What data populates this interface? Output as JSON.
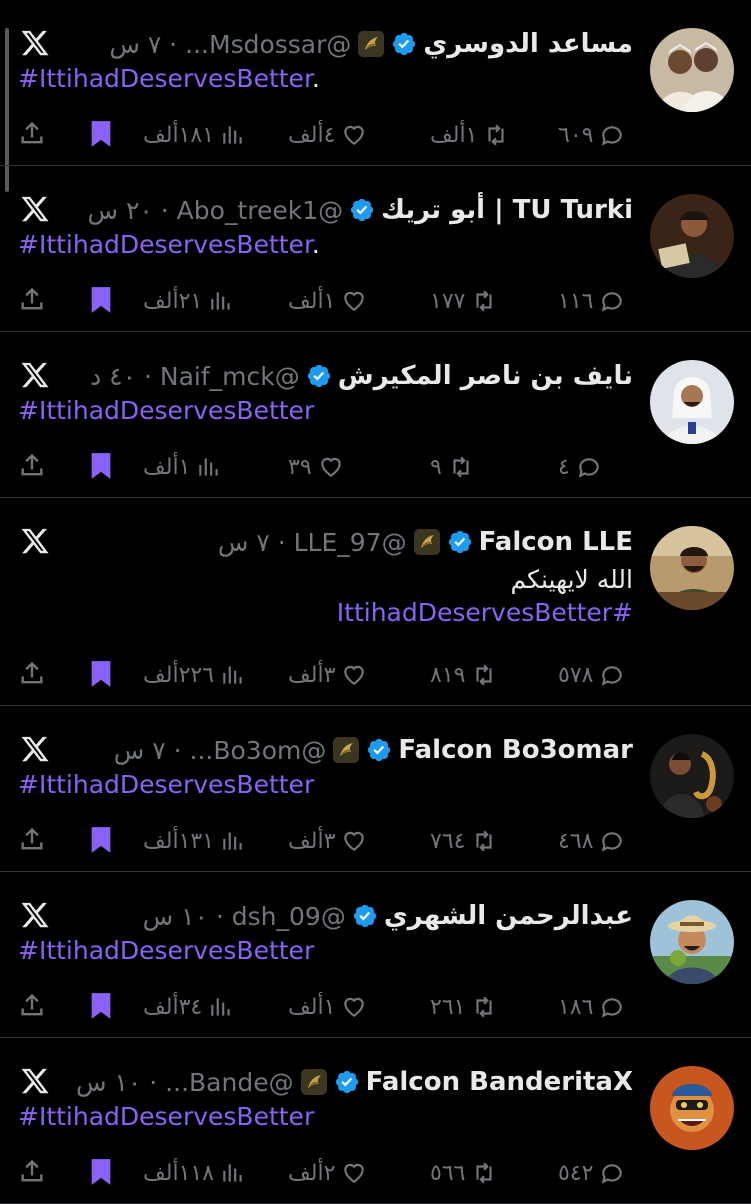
{
  "accent": "#8a62f5",
  "tweets": [
    {
      "name": "مساعد الدوسري",
      "handle": "@Msdossar...",
      "time": "٧ س",
      "affiliate_badge": true,
      "text_lines": [],
      "hashtag": "#IttihadDeservesBetter",
      "trailing_period": ".",
      "replies": "٦٠٩",
      "reposts": "١ألف",
      "likes": "٤ألف",
      "views": "١٨١ألف",
      "avatar": "two-men-avatar"
    },
    {
      "name": "TU Turki | أبو تريك",
      "handle": "@Abo_treek1",
      "time": "٢٠ س",
      "affiliate_badge": false,
      "text_lines": [],
      "hashtag": "#IttihadDeservesBetter",
      "trailing_period": ".",
      "replies": "١١٦",
      "reposts": "١٧٧",
      "likes": "١ألف",
      "views": "٢١ألف",
      "avatar": "man-reading-avatar"
    },
    {
      "name": "نايف بن ناصر المكيرش",
      "handle": "@Naif_mck",
      "time": "٤٠ د",
      "affiliate_badge": false,
      "text_lines": [],
      "hashtag": "#IttihadDeservesBetter",
      "trailing_period": "",
      "replies": "٤",
      "reposts": "٩",
      "likes": "٣٩",
      "views": "١ألف",
      "avatar": "man-ghutra-avatar"
    },
    {
      "name": "Falcon LLE",
      "handle": "@LLE_97",
      "time": "٧ س",
      "affiliate_badge": true,
      "text_lines": [
        "الله لايهينكم"
      ],
      "hashtag": "#IttihadDeservesBetter",
      "trailing_period": "",
      "replies": "٥٧٨",
      "reposts": "٨١٩",
      "likes": "٣ألف",
      "views": "٢٢٦ألف",
      "avatar": "man-desk-avatar"
    },
    {
      "name": "Falcon Bo3omar",
      "handle": "@Bo3om...",
      "time": "٧ س",
      "affiliate_badge": true,
      "text_lines": [],
      "hashtag": "#IttihadDeservesBetter",
      "trailing_period": "",
      "replies": "٤٦٨",
      "reposts": "٧٦٤",
      "likes": "٣ألف",
      "views": "١٣١ألف",
      "avatar": "man-saxophone-avatar"
    },
    {
      "name": "عبدالرحمن الشهري",
      "handle": "@dsh_09",
      "time": "١٠ س",
      "affiliate_badge": false,
      "text_lines": [],
      "hashtag": "#IttihadDeservesBetter",
      "trailing_period": "",
      "replies": "١٨٦",
      "reposts": "٢٦١",
      "likes": "١ألف",
      "views": "٣٤ألف",
      "avatar": "man-hat-avatar"
    },
    {
      "name": "Falcon BanderitaX",
      "handle": "@Bande...",
      "time": "١٠ س",
      "affiliate_badge": true,
      "text_lines": [],
      "hashtag": "#IttihadDeservesBetter",
      "trailing_period": "",
      "replies": "٥٤٢",
      "reposts": "٥٦٦",
      "likes": "٢ألف",
      "views": "١١٨ألف",
      "avatar": "cartoon-character-avatar"
    }
  ]
}
